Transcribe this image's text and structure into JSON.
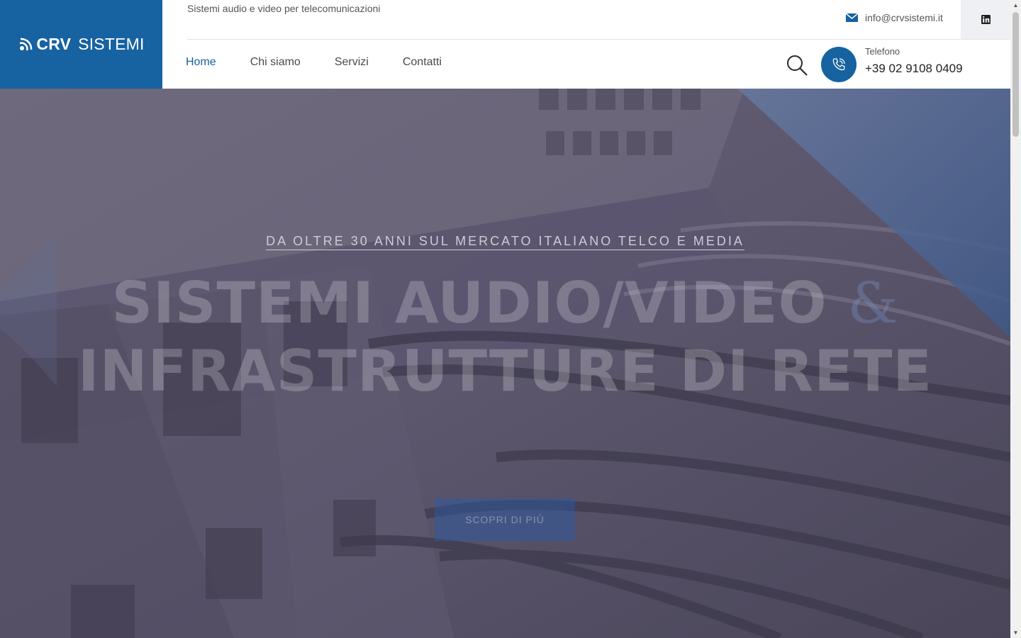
{
  "brand": {
    "logo_bold": "CRV",
    "logo_rest": "SISTEMI",
    "tagline": "Sistemi audio e video per telecomunicazioni",
    "primary_color": "#1762a0"
  },
  "contact": {
    "email": "info@crvsistemi.it",
    "email_icon": "envelope-icon",
    "social_icon": "linkedin-icon",
    "phone_label": "Telefono",
    "phone_number": "+39 02 9108 0409",
    "phone_icon": "phone-icon"
  },
  "nav": {
    "items": [
      {
        "label": "Home",
        "active": true
      },
      {
        "label": "Chi siamo",
        "active": false
      },
      {
        "label": "Servizi",
        "active": false
      },
      {
        "label": "Contatti",
        "active": false
      }
    ],
    "search_icon": "search-icon"
  },
  "hero": {
    "subtitle": "Da oltre 30 anni sul mercato italiano Telco e Media",
    "title_line1": "Sistemi audio/video",
    "title_amp": "&",
    "title_line2": "infrastrutture di rete",
    "cta_label": "Scopri di più",
    "background": "network-switch-photo"
  }
}
